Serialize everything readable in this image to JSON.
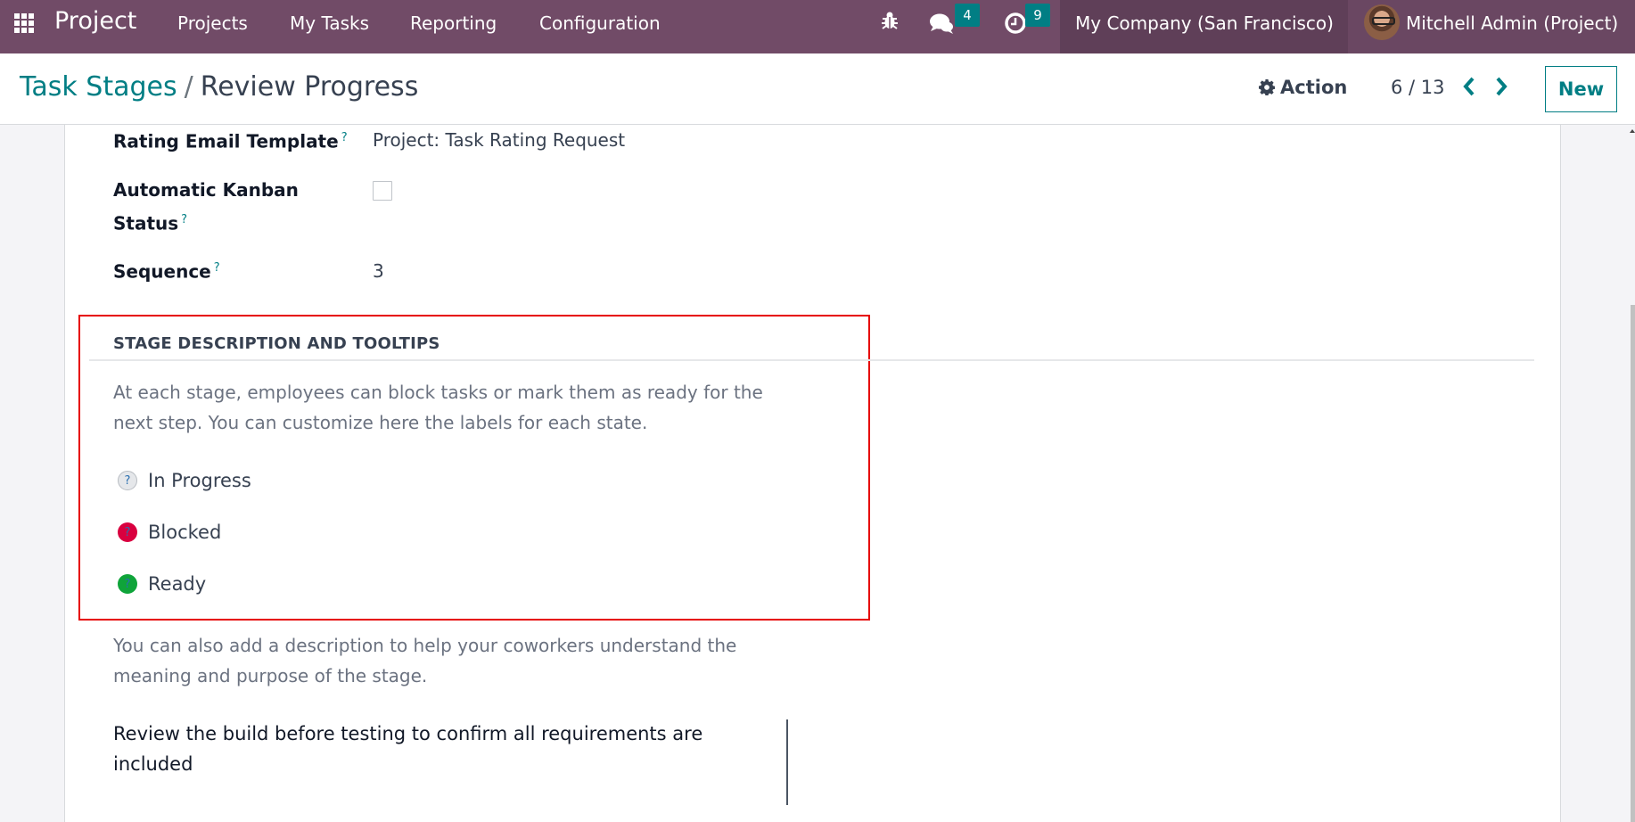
{
  "navbar": {
    "brand": "Project",
    "menu": [
      "Projects",
      "My Tasks",
      "Reporting",
      "Configuration"
    ],
    "messages_count": "4",
    "activities_count": "9",
    "company": "My Company (San Francisco)",
    "user": "Mitchell Admin (Project)",
    "bg_color": "#714b67"
  },
  "control_panel": {
    "breadcrumb_parent": "Task Stages",
    "breadcrumb_separator": "/",
    "breadcrumb_current": "Review Progress",
    "action_label": "Action",
    "pager": "6 / 13",
    "new_label": "New"
  },
  "form": {
    "fields": [
      {
        "label": "Rating Email Template",
        "help": "?",
        "value": "Project: Task Rating Request"
      },
      {
        "label_line1": "Automatic Kanban",
        "label_line2": "Status",
        "help": "?",
        "checked": false
      },
      {
        "label": "Sequence",
        "help": "?",
        "value": "3"
      }
    ],
    "section": {
      "title": "STAGE DESCRIPTION AND TOOLTIPS",
      "intro_line1": "At each stage, employees can block tasks or mark them as ready for the",
      "intro_line2": "next step. You can customize here the labels for each state.",
      "states": [
        {
          "label": "In Progress",
          "icon": "?",
          "color": "#e5e7ea"
        },
        {
          "label": "Blocked",
          "icon": "?",
          "color": "#d9003f"
        },
        {
          "label": "Ready",
          "icon": "?",
          "color": "#0fa43a"
        }
      ],
      "description_hint_line1": "You can also add a description to help your coworkers understand the",
      "description_hint_line2": "meaning and purpose of the stage.",
      "description_line1": "Review the build before testing to confirm all requirements are",
      "description_line2": "included"
    }
  },
  "accent_color": "#017e84",
  "highlight_color": "#e60000"
}
